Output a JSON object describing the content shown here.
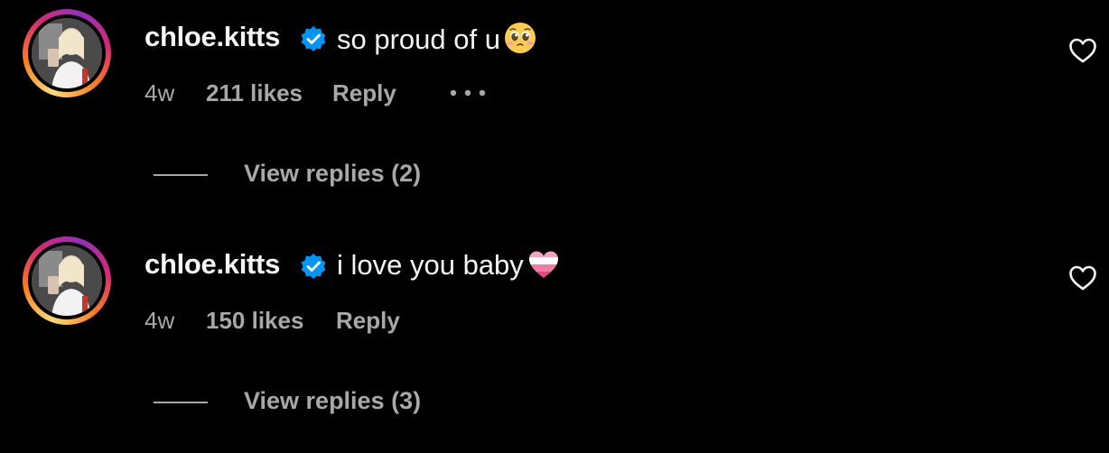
{
  "comments": [
    {
      "username": "chloe.kitts",
      "verified_icon": "verified-badge-icon",
      "text": "so proud of u",
      "emoji_icon": "pleading-face-emoji",
      "age": "4w",
      "likes": "211 likes",
      "reply_label": "Reply",
      "more_icon": "more-options-icon",
      "like_icon": "heart-outline-icon",
      "view_replies": "View replies (2)"
    },
    {
      "username": "chloe.kitts",
      "verified_icon": "verified-badge-icon",
      "text": "i love you baby",
      "emoji_icon": "pink-white-heart-emoji",
      "age": "4w",
      "likes": "150 likes",
      "reply_label": "Reply",
      "like_icon": "heart-outline-icon",
      "view_replies": "View replies (3)"
    }
  ],
  "colors": {
    "background": "#000000",
    "primary_text": "#f5f5f5",
    "secondary_text": "#a8a8a8",
    "verified_blue": "#0095f6"
  }
}
